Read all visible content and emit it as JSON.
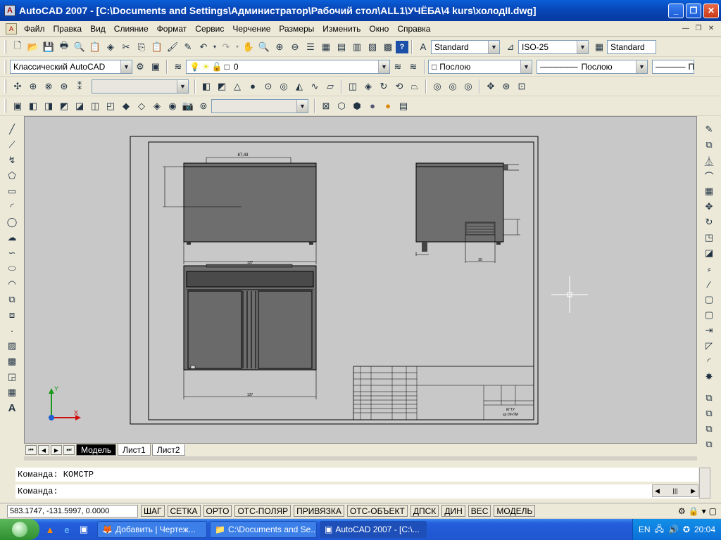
{
  "window": {
    "title": "AutoCAD 2007 - [C:\\Documents and Settings\\Администратор\\Рабочий стол\\ALL1\\УЧЁБА\\4 kurs\\холодII.dwg]"
  },
  "menu": [
    "Файл",
    "Правка",
    "Вид",
    "Слияние",
    "Формат",
    "Сервис",
    "Черчение",
    "Размеры",
    "Изменить",
    "Окно",
    "Справка"
  ],
  "toolbars": {
    "text_style": "Standard",
    "dim_style": "ISO-25",
    "table_style": "Standard",
    "workspace": "Классический AutoCAD",
    "layer": "0",
    "color": "Послою",
    "linetype": "Послою",
    "lineweight": "П",
    "ucs_combo": "",
    "view_combo": ""
  },
  "drawing": {
    "dim_top": "87,43",
    "dim_width_top": "137",
    "dim_width_bottom": "137",
    "dim_side_small": "30",
    "title_block_text1": "КГТУ",
    "title_block_text2": "гр 09-ПМ"
  },
  "layout_tabs": [
    "Модель",
    "Лист1",
    "Лист2"
  ],
  "active_tab": "Модель",
  "command": {
    "history": "Команда:  КОМСТР",
    "prompt": "Команда:"
  },
  "status": {
    "coords": "583.1747, -131.5997, 0.0000",
    "toggles": [
      "ШАГ",
      "СЕТКА",
      "ОРТО",
      "ОТС-ПОЛЯР",
      "ПРИВЯЗКА",
      "ОТС-ОБЪЕКТ",
      "ДПСК",
      "ДИН",
      "ВЕС",
      "МОДЕЛЬ"
    ]
  },
  "taskbar": {
    "tasks": [
      "Добавить | Чертеж...",
      "C:\\Documents and Se...",
      "AutoCAD 2007 - [C:\\..."
    ],
    "active_task": 2,
    "lang": "EN",
    "clock": "20:04"
  }
}
